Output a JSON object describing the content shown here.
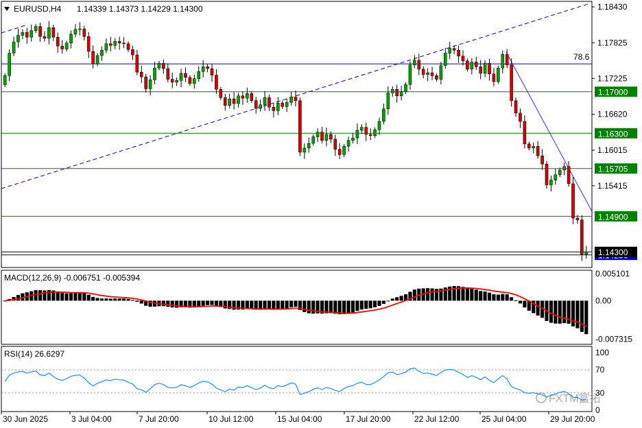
{
  "header": {
    "symbol": "EURUSD,H4",
    "ohlc": "1.14339 1.14373 1.14229 1.14300",
    "menu_icon": "triangle-down-icon"
  },
  "chart_data": [
    {
      "type": "candlestick",
      "title": "EURUSD,H4",
      "ylim": [
        1.1406,
        1.185
      ],
      "y_ticks": [
        "1.18430",
        "1.17825",
        "1.17225",
        "1.16620",
        "1.16015",
        "1.15415"
      ],
      "levels": [
        {
          "value": 1.17,
          "label": "1.17000",
          "color": "#008000"
        },
        {
          "value": 1.163,
          "label": "1.16300",
          "color": "#008000"
        },
        {
          "value": 1.15705,
          "label": "1.15705",
          "color": "#008000"
        },
        {
          "value": 1.149,
          "label": "1.14900",
          "color": "#008000"
        },
        {
          "value": 1.1425,
          "label": "1.14250",
          "color": "#0000cc"
        },
        {
          "value": 1.143,
          "label": "1.14300",
          "color": "#000000"
        }
      ],
      "fib_label": "78.6",
      "fib_level": 1.1747,
      "colors": {
        "up": "#00a000",
        "down": "#d00000",
        "grid": "#000000"
      },
      "close": [
        1.1727,
        1.1765,
        1.1784,
        1.1795,
        1.18,
        1.1792,
        1.1803,
        1.181,
        1.1793,
        1.179,
        1.1808,
        1.1792,
        1.1777,
        1.1772,
        1.1782,
        1.1797,
        1.1805,
        1.1806,
        1.1793,
        1.1768,
        1.1747,
        1.1761,
        1.177,
        1.1781,
        1.1778,
        1.1785,
        1.1782,
        1.1781,
        1.1771,
        1.1762,
        1.1733,
        1.1725,
        1.1705,
        1.172,
        1.174,
        1.1748,
        1.1739,
        1.1721,
        1.1716,
        1.1719,
        1.1731,
        1.1724,
        1.1714,
        1.1722,
        1.1734,
        1.1742,
        1.1739,
        1.1728,
        1.1704,
        1.169,
        1.1677,
        1.1688,
        1.168,
        1.1693,
        1.1689,
        1.1697,
        1.1685,
        1.1672,
        1.1678,
        1.169,
        1.1674,
        1.1668,
        1.1681,
        1.1675,
        1.1682,
        1.1691,
        1.1685,
        1.1598,
        1.1605,
        1.1613,
        1.1624,
        1.1632,
        1.1618,
        1.1628,
        1.162,
        1.1603,
        1.1594,
        1.1608,
        1.1618,
        1.1622,
        1.1635,
        1.164,
        1.1628,
        1.1626,
        1.1636,
        1.165,
        1.1671,
        1.1698,
        1.1704,
        1.1693,
        1.17,
        1.1712,
        1.1745,
        1.1753,
        1.1738,
        1.1729,
        1.1732,
        1.1727,
        1.1721,
        1.1744,
        1.1765,
        1.1773,
        1.177,
        1.176,
        1.1752,
        1.1738,
        1.175,
        1.1742,
        1.1731,
        1.1748,
        1.173,
        1.1717,
        1.174,
        1.1763,
        1.1745,
        1.1685,
        1.1664,
        1.165,
        1.1612,
        1.1605,
        1.1608,
        1.1592,
        1.1578,
        1.1543,
        1.1551,
        1.156,
        1.1568,
        1.1574,
        1.1545,
        1.1487,
        1.1484,
        1.1426,
        1.143
      ],
      "ma_series_name": "MACD(12,26,9)",
      "macd": {
        "label": "MACD(12,26,9) -0.006751 -0.005394",
        "ylim": [
          -0.008,
          0.0055
        ],
        "ticks": [
          "0.005101",
          "0.00",
          "-0.007315"
        ],
        "signal_color": "#ff0000"
      },
      "rsi": {
        "label": "RSI(14) 26.6297",
        "ylim": [
          0,
          100
        ],
        "ticks": [
          "100",
          "70",
          "30",
          "0"
        ],
        "line_color": "#1e90ff"
      },
      "x_labels": [
        "30 Jun 2025",
        "3 Jul 04:00",
        "7 Jul 20:00",
        "10 Jul 12:00",
        "15 Jul 04:00",
        "17 Jul 20:00",
        "22 Jul 12:00",
        "25 Jul 04:00",
        "29 Jul 20:00"
      ]
    }
  ],
  "watermark": "FXTM富拓"
}
